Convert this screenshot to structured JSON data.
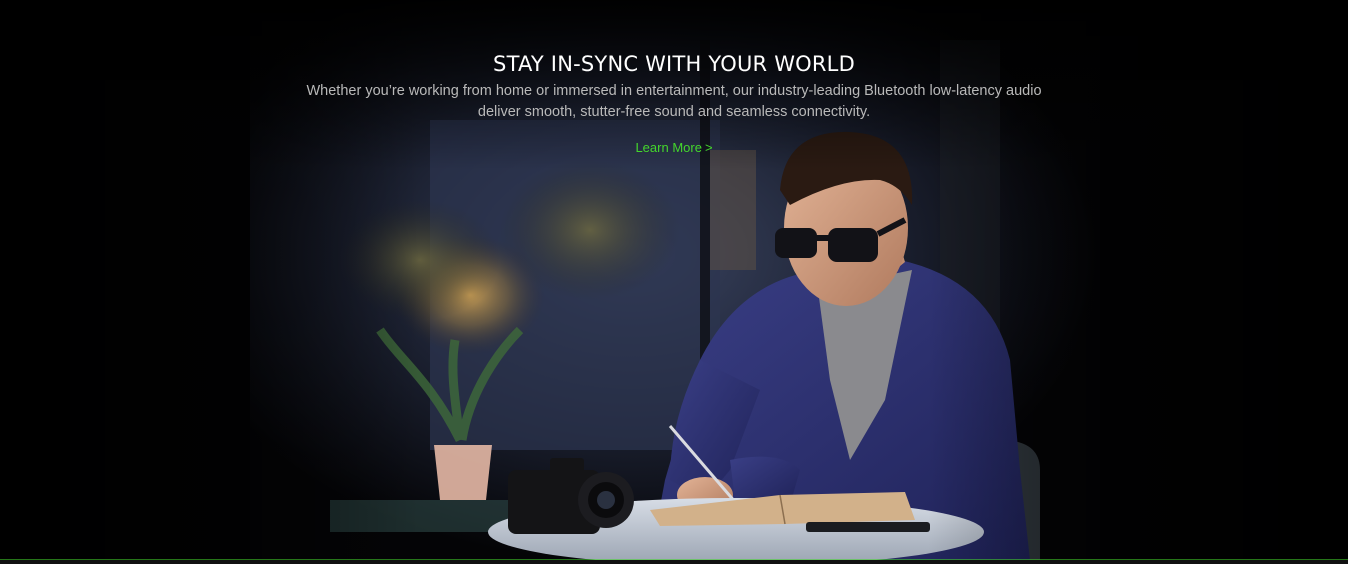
{
  "hero": {
    "title": "STAY IN-SYNC WITH YOUR WORLD",
    "description": "Whether you’re working from home or immersed in entertainment, our industry-leading Bluetooth low-latency audio deliver smooth, stutter-free sound and seamless connectivity.",
    "link_label": "Learn More",
    "link_chevron": ">",
    "image": "man-with-audio-glasses-writing-at-table-photo"
  },
  "colors": {
    "accent": "#44d62c",
    "title": "#ffffff",
    "body_text": "#b9b9b9",
    "background": "#000000"
  }
}
